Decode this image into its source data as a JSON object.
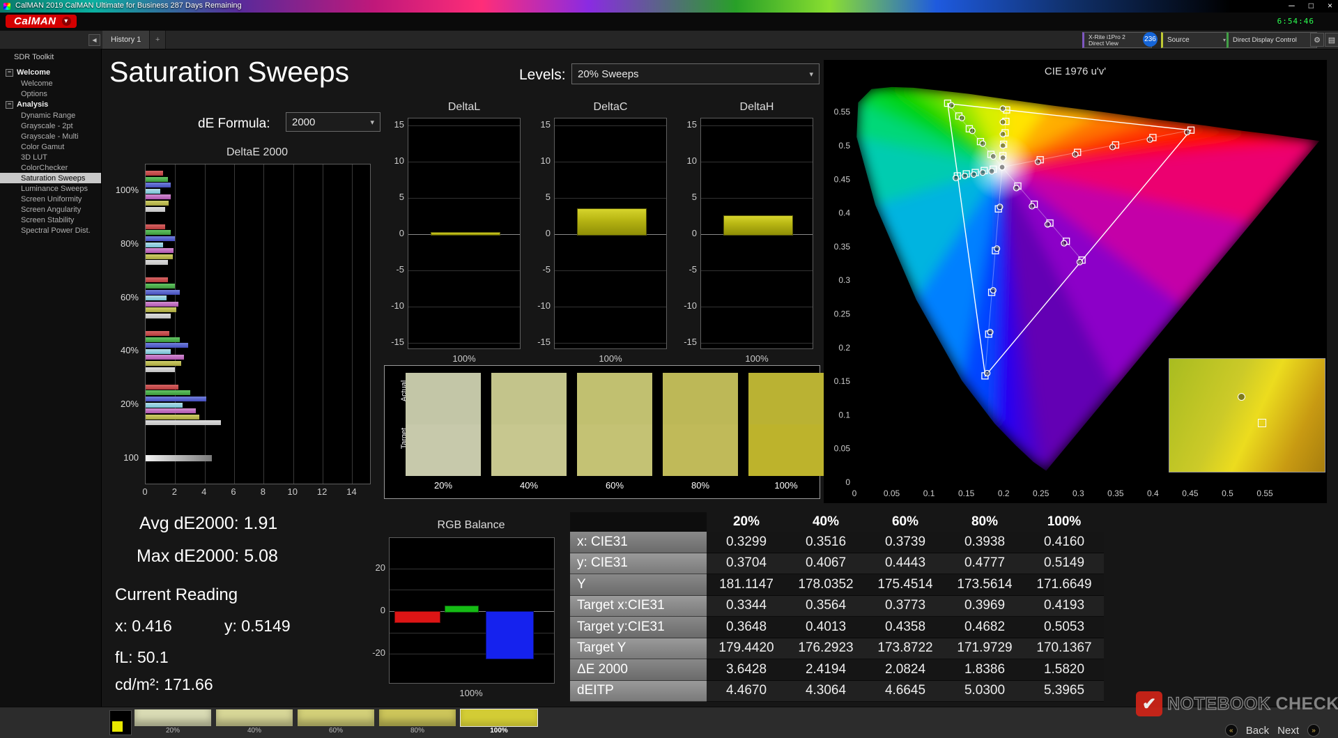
{
  "window": {
    "title": "CalMAN 2019 CalMAN Ultimate for Business 287 Days Remaining",
    "logo_text": "CalMAN",
    "timer": "6:54:46"
  },
  "icons": {
    "caret_down": "▾",
    "gear": "⚙",
    "display": "▤",
    "collapse": "◀",
    "minimize": "─",
    "maximize": "□",
    "close": "×",
    "back_circle": "«",
    "next_circle": "»",
    "check": "✔",
    "expander": "−"
  },
  "toolbar": {
    "tab_label": "History 1",
    "tab_add": "+",
    "meter": {
      "line1": "X-Rite i1Pro 2",
      "line2": "Direct View"
    },
    "badge": "236",
    "source_label": "Source",
    "display_label": "Direct Display Control"
  },
  "sidebar": {
    "title": "SDR Toolkit",
    "groups": [
      {
        "label": "Welcome",
        "items": [
          {
            "label": "Welcome"
          },
          {
            "label": "Options"
          }
        ]
      },
      {
        "label": "Analysis",
        "items": [
          {
            "label": "Dynamic Range"
          },
          {
            "label": "Grayscale - 2pt"
          },
          {
            "label": "Grayscale - Multi"
          },
          {
            "label": "Color Gamut"
          },
          {
            "label": "3D LUT"
          },
          {
            "label": "ColorChecker"
          },
          {
            "label": "Saturation Sweeps",
            "selected": true
          },
          {
            "label": "Luminance Sweeps"
          },
          {
            "label": "Screen Uniformity"
          },
          {
            "label": "Screen Angularity"
          },
          {
            "label": "Screen Stability"
          },
          {
            "label": "Spectral Power Dist."
          }
        ]
      }
    ]
  },
  "page": {
    "title": "Saturation Sweeps",
    "levels_label": "Levels:",
    "levels_value": "20% Sweeps",
    "formula_label": "dE Formula:",
    "formula_value": "2000"
  },
  "stats": {
    "avg": "Avg dE2000: 1.91",
    "max": "Max dE2000: 5.08",
    "current_heading": "Current Reading",
    "x": "x: 0.416",
    "y": "y: 0.5149",
    "fl": "fL: 50.1",
    "cd": "cd/m²: 171.66"
  },
  "swatch_panel": {
    "actual_label": "Actual",
    "target_label": "Target",
    "swatches": [
      {
        "label": "20%",
        "actual": "#c3c6a7",
        "target": "#c7c9ab"
      },
      {
        "label": "40%",
        "actual": "#c3c48b",
        "target": "#c7c78f"
      },
      {
        "label": "60%",
        "actual": "#c1c070",
        "target": "#c4c274"
      },
      {
        "label": "80%",
        "actual": "#bdb857",
        "target": "#c0ba59"
      },
      {
        "label": "100%",
        "actual": "#bab233",
        "target": "#bdb32c"
      }
    ]
  },
  "table": {
    "col_headers": [
      "20%",
      "40%",
      "60%",
      "80%",
      "100%"
    ],
    "rows": [
      {
        "label": "x: CIE31",
        "values": [
          "0.3299",
          "0.3516",
          "0.3739",
          "0.3938",
          "0.4160"
        ]
      },
      {
        "label": "y: CIE31",
        "values": [
          "0.3704",
          "0.4067",
          "0.4443",
          "0.4777",
          "0.5149"
        ]
      },
      {
        "label": "Y",
        "values": [
          "181.1147",
          "178.0352",
          "175.4514",
          "173.5614",
          "171.6649"
        ]
      },
      {
        "label": "Target x:CIE31",
        "values": [
          "0.3344",
          "0.3564",
          "0.3773",
          "0.3969",
          "0.4193"
        ]
      },
      {
        "label": "Target y:CIE31",
        "values": [
          "0.3648",
          "0.4013",
          "0.4358",
          "0.4682",
          "0.5053"
        ]
      },
      {
        "label": "Target Y",
        "values": [
          "179.4420",
          "176.2923",
          "173.8722",
          "171.9729",
          "170.1367"
        ]
      },
      {
        "label": "ΔE 2000",
        "values": [
          "3.6428",
          "2.4194",
          "2.0824",
          "1.8386",
          "1.5820"
        ]
      },
      {
        "label": "dEITP",
        "values": [
          "4.4670",
          "4.3064",
          "4.6645",
          "5.0300",
          "5.3965"
        ]
      }
    ]
  },
  "bottom_bar": {
    "patch_color": "#e8e800",
    "thumbs": [
      {
        "label": "20%",
        "color": "#d9dbb4"
      },
      {
        "label": "40%",
        "color": "#d7d697"
      },
      {
        "label": "60%",
        "color": "#d2cf78"
      },
      {
        "label": "80%",
        "color": "#ccc55a"
      },
      {
        "label": "100%",
        "color": "#d3cc35",
        "selected": true
      }
    ],
    "back": "Back",
    "next": "Next"
  },
  "watermark": {
    "name1": "NOTEBOOK",
    "name2": "CHECK"
  },
  "chart_data": [
    {
      "id": "deltaE",
      "type": "bar",
      "orientation": "horizontal",
      "title": "DeltaE 2000",
      "xlim": [
        0,
        15.3
      ],
      "xticks": [
        0,
        2,
        4,
        6,
        8,
        10,
        12,
        14
      ],
      "color_names": [
        "Red",
        "Green",
        "Blue",
        "Cyan",
        "Magenta",
        "Yellow",
        "White"
      ],
      "bar_colors": [
        "#c14a4a",
        "#4aa84a",
        "#5560c8",
        "#8ccbdc",
        "#bb6abb",
        "#b6b44e",
        "#cccccc"
      ],
      "groups": [
        {
          "label": "100%",
          "values": [
            1.2,
            1.5,
            1.7,
            1.0,
            1.7,
            1.58,
            1.3
          ]
        },
        {
          "label": "80%",
          "values": [
            1.3,
            1.7,
            2.0,
            1.2,
            1.9,
            1.84,
            1.5
          ]
        },
        {
          "label": "60%",
          "values": [
            1.5,
            2.0,
            2.3,
            1.4,
            2.2,
            2.08,
            1.7
          ]
        },
        {
          "label": "40%",
          "values": [
            1.6,
            2.3,
            2.9,
            1.7,
            2.6,
            2.42,
            2.0
          ]
        },
        {
          "label": "20%",
          "values": [
            2.2,
            3.0,
            4.1,
            2.5,
            3.4,
            3.64,
            5.08
          ]
        },
        {
          "label": "100",
          "values": [
            4.5
          ],
          "white": true
        }
      ]
    },
    {
      "id": "deltaL",
      "type": "bar",
      "title": "DeltaL",
      "ylim": [
        -15,
        15
      ],
      "yticks": [
        15,
        10,
        5,
        0,
        -5,
        -10,
        -15
      ],
      "categories": [
        "100%"
      ],
      "values": [
        0.3
      ]
    },
    {
      "id": "deltaC",
      "type": "bar",
      "title": "DeltaC",
      "ylim": [
        -15,
        15
      ],
      "yticks": [
        15,
        10,
        5,
        0,
        -5,
        -10,
        -15
      ],
      "categories": [
        "100%"
      ],
      "values": [
        3.6
      ]
    },
    {
      "id": "deltaH",
      "type": "bar",
      "title": "DeltaH",
      "ylim": [
        -15,
        15
      ],
      "yticks": [
        15,
        10,
        5,
        0,
        -5,
        -10,
        -15
      ],
      "categories": [
        "100%"
      ],
      "values": [
        2.6
      ]
    },
    {
      "id": "rgb",
      "type": "bar",
      "title": "RGB Balance",
      "ylim": [
        -31,
        31
      ],
      "yticks": [
        20,
        0,
        -20
      ],
      "gridlines": [
        20,
        10,
        0,
        -10,
        -20
      ],
      "categories": [
        "100%"
      ],
      "series": [
        {
          "name": "Red",
          "value": -5,
          "color": "#dd1515"
        },
        {
          "name": "Green",
          "value": 2.5,
          "color": "#15bb15"
        },
        {
          "name": "Blue",
          "value": -22,
          "color": "#1522ee"
        }
      ]
    },
    {
      "id": "cie",
      "type": "scatter",
      "title": "CIE 1976 u'v'",
      "xlim": [
        0,
        0.62
      ],
      "ylim": [
        0,
        0.59
      ],
      "xticks": [
        "0",
        "0.05",
        "0.1",
        "0.15",
        "0.2",
        "0.25",
        "0.3",
        "0.35",
        "0.4",
        "0.45",
        "0.5",
        "0.55"
      ],
      "yticks": [
        "0",
        "0.05",
        "0.1",
        "0.15",
        "0.2",
        "0.25",
        "0.3",
        "0.35",
        "0.4",
        "0.45",
        "0.5",
        "0.55"
      ],
      "white_point": [
        0.198,
        0.468
      ],
      "gamut_triangle": [
        [
          0.4507,
          0.5229
        ],
        [
          0.125,
          0.5625
        ],
        [
          0.1754,
          0.1579
        ]
      ],
      "locus": [
        [
          0.623,
          0.507,
          "#ff0000"
        ],
        [
          0.557,
          0.517,
          "#ff0800"
        ],
        [
          0.52,
          0.522,
          "#ff1c00"
        ],
        [
          0.469,
          0.53,
          "#ff3c00"
        ],
        [
          0.403,
          0.539,
          "#ff7400"
        ],
        [
          0.332,
          0.55,
          "#ffae00"
        ],
        [
          0.262,
          0.56,
          "#ffe400"
        ],
        [
          0.203,
          0.569,
          "#d8f000"
        ],
        [
          0.153,
          0.577,
          "#9ce800"
        ],
        [
          0.113,
          0.582,
          "#5ce000"
        ],
        [
          0.079,
          0.586,
          "#1ed800"
        ],
        [
          0.05,
          0.587,
          "#00d200"
        ],
        [
          0.023,
          0.584,
          "#00d836"
        ],
        [
          0.005,
          0.564,
          "#00d878"
        ],
        [
          0.003,
          0.513,
          "#00ccb0"
        ],
        [
          0.028,
          0.412,
          "#00b4e0"
        ],
        [
          0.083,
          0.271,
          "#0080ff"
        ],
        [
          0.144,
          0.151,
          "#0044ff"
        ],
        [
          0.188,
          0.087,
          "#2000f4"
        ],
        [
          0.216,
          0.055,
          "#3c00dc"
        ],
        [
          0.24,
          0.03,
          "#5200c4"
        ],
        [
          0.257,
          0.017,
          "#6400b4"
        ],
        [
          0.349,
          0.14,
          "#8c00c8"
        ],
        [
          0.44,
          0.262,
          "#c400a8"
        ],
        [
          0.532,
          0.385,
          "#ec0070"
        ],
        [
          0.623,
          0.507,
          "#ff0040"
        ]
      ],
      "sweeps": [
        {
          "name": "red",
          "targets": [
            [
              0.249,
              0.479
            ],
            [
              0.299,
              0.49
            ],
            [
              0.35,
              0.501
            ],
            [
              0.4,
              0.512
            ],
            [
              0.451,
              0.523
            ]
          ],
          "measured": [
            [
              0.246,
              0.476
            ],
            [
              0.296,
              0.487
            ],
            [
              0.346,
              0.498
            ],
            [
              0.396,
              0.509
            ],
            [
              0.446,
              0.52
            ]
          ]
        },
        {
          "name": "green",
          "targets": [
            [
              0.183,
              0.487
            ],
            [
              0.169,
              0.506
            ],
            [
              0.154,
              0.525
            ],
            [
              0.14,
              0.544
            ],
            [
              0.125,
              0.563
            ]
          ],
          "measured": [
            [
              0.186,
              0.484
            ],
            [
              0.172,
              0.503
            ],
            [
              0.158,
              0.522
            ],
            [
              0.144,
              0.541
            ],
            [
              0.13,
              0.56
            ]
          ]
        },
        {
          "name": "blue",
          "targets": [
            [
              0.193,
              0.406
            ],
            [
              0.189,
              0.344
            ],
            [
              0.184,
              0.282
            ],
            [
              0.18,
              0.22
            ],
            [
              0.175,
              0.158
            ]
          ],
          "measured": [
            [
              0.195,
              0.409
            ],
            [
              0.191,
              0.347
            ],
            [
              0.186,
              0.285
            ],
            [
              0.182,
              0.223
            ],
            [
              0.178,
              0.162
            ]
          ]
        },
        {
          "name": "cyan",
          "targets": [
            [
              0.186,
              0.465
            ],
            [
              0.174,
              0.463
            ],
            [
              0.162,
              0.46
            ],
            [
              0.15,
              0.458
            ],
            [
              0.138,
              0.455
            ]
          ],
          "measured": [
            [
              0.184,
              0.462
            ],
            [
              0.172,
              0.46
            ],
            [
              0.16,
              0.457
            ],
            [
              0.148,
              0.455
            ],
            [
              0.136,
              0.452
            ]
          ]
        },
        {
          "name": "magenta",
          "targets": [
            [
              0.219,
              0.44
            ],
            [
              0.241,
              0.413
            ],
            [
              0.262,
              0.385
            ],
            [
              0.284,
              0.358
            ],
            [
              0.305,
              0.33
            ]
          ],
          "measured": [
            [
              0.217,
              0.437
            ],
            [
              0.238,
              0.41
            ],
            [
              0.259,
              0.383
            ],
            [
              0.281,
              0.355
            ],
            [
              0.302,
              0.327
            ]
          ]
        },
        {
          "name": "yellow",
          "targets": [
            [
              0.199,
              0.485
            ],
            [
              0.2,
              0.502
            ],
            [
              0.202,
              0.519
            ],
            [
              0.203,
              0.536
            ],
            [
              0.204,
              0.553
            ]
          ],
          "measured": [
            [
              0.199,
              0.482
            ],
            [
              0.199,
              0.5
            ],
            [
              0.199,
              0.517
            ],
            [
              0.199,
              0.535
            ],
            [
              0.199,
              0.555
            ]
          ]
        },
        {
          "name": "white",
          "targets": [],
          "measured": [
            [
              0.198,
              0.468
            ]
          ]
        }
      ],
      "inset": {
        "markers": {
          "circle": [
            0.44,
            0.3
          ],
          "square": [
            0.57,
            0.53
          ]
        }
      }
    }
  ]
}
